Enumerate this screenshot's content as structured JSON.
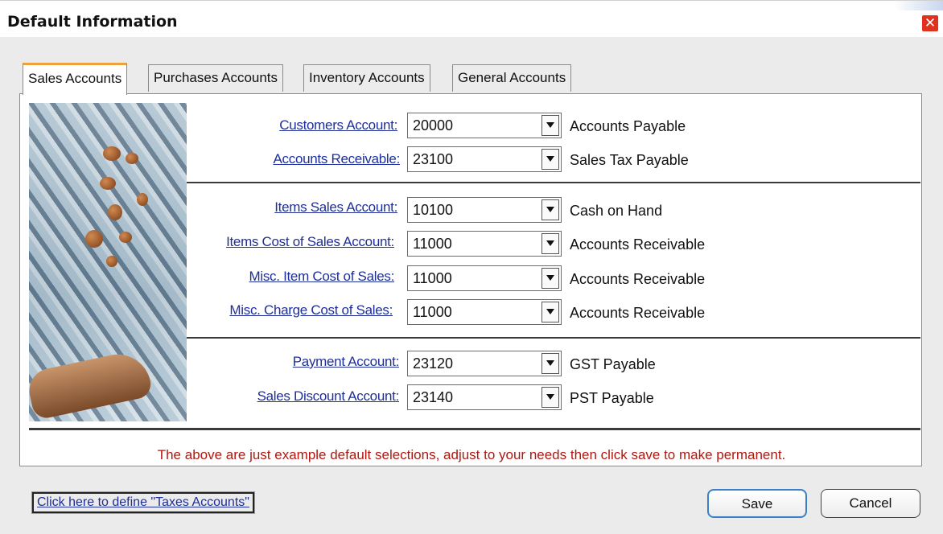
{
  "window": {
    "title": "Default Information",
    "close_symbol": "✕"
  },
  "tabs": [
    {
      "label": "Sales Accounts",
      "active": true
    },
    {
      "label": "Purchases Accounts",
      "active": false
    },
    {
      "label": "Inventory Accounts",
      "active": false
    },
    {
      "label": "General Accounts",
      "active": false
    }
  ],
  "groups": [
    {
      "rows": [
        {
          "label": "Customers Account:",
          "value": "20000",
          "desc": "Accounts Payable"
        },
        {
          "label": "Accounts Receivable:",
          "value": "23100",
          "desc": "Sales Tax Payable"
        }
      ]
    },
    {
      "rows": [
        {
          "label": "Items Sales Account:",
          "value": "10100",
          "desc": "Cash on Hand"
        },
        {
          "label": "Items Cost of Sales Account:",
          "value": "11000",
          "desc": "Accounts Receivable"
        },
        {
          "label": "Misc. Item Cost of Sales:",
          "value": "11000",
          "desc": "Accounts Receivable"
        },
        {
          "label": "Misc. Charge Cost of Sales:",
          "value": "11000",
          "desc": "Accounts Receivable"
        }
      ]
    },
    {
      "rows": [
        {
          "label": "Payment Account:",
          "value": "23120",
          "desc": "GST Payable"
        },
        {
          "label": "Sales Discount Account:",
          "value": "23140",
          "desc": "PST Payable"
        }
      ]
    }
  ],
  "note": "The above are just example default selections, adjust to your needs then click save to make permanent.",
  "taxes_link": "Click here to define \"Taxes Accounts\"",
  "buttons": {
    "save": "Save",
    "cancel": "Cancel"
  },
  "colors": {
    "link": "#1e2f9a",
    "note": "#b0170e",
    "active_tab_accent": "#f0a03a"
  },
  "icons": {
    "close": "close-icon",
    "dropdown": "chevron-down-icon"
  }
}
